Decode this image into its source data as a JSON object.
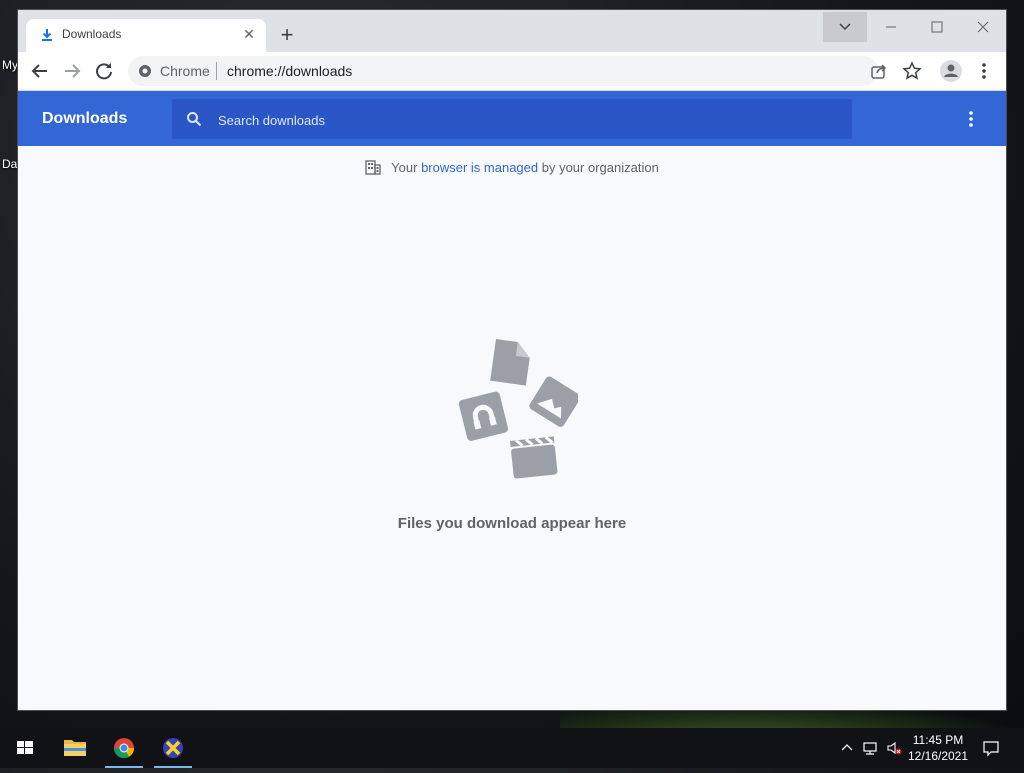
{
  "desktop": {
    "icons": [
      {
        "label": "My"
      },
      {
        "label": "Da"
      }
    ]
  },
  "browser": {
    "tab": {
      "title": "Downloads",
      "icon": "download-icon"
    },
    "new_tab_label": "+",
    "omnibox": {
      "site": "Chrome",
      "url": "chrome://downloads"
    },
    "window_controls": [
      "minimize",
      "maximize",
      "close"
    ]
  },
  "downloads_page": {
    "title": "Downloads",
    "search": {
      "placeholder": "Search downloads",
      "value": ""
    },
    "managed_notice": {
      "before": "Your ",
      "link": "browser is managed",
      "after": " by your organization"
    },
    "empty_message": "Files you download appear here"
  },
  "taskbar": {
    "apps": [
      "start-icon",
      "file-explorer-icon",
      "chrome-icon",
      "x-app-icon"
    ],
    "clock": {
      "time": "11:45 PM",
      "date": "12/16/2021"
    }
  },
  "colors": {
    "header": "#3367d6",
    "search_box": "#2a56c6",
    "page_bg": "#f8f9fa",
    "link": "#3367d6"
  }
}
